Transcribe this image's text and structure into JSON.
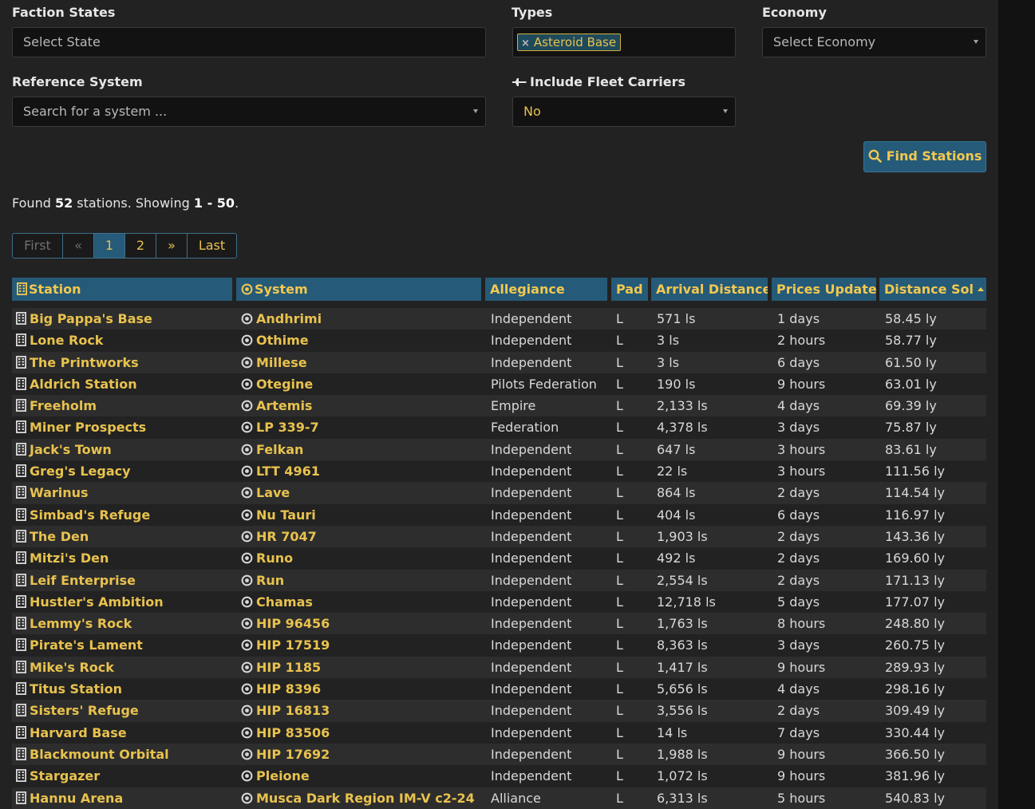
{
  "filters": {
    "faction_states": {
      "label": "Faction States",
      "placeholder": "Select State"
    },
    "types": {
      "label": "Types",
      "selected_tags": [
        "Asteroid Base"
      ]
    },
    "economy": {
      "label": "Economy",
      "placeholder": "Select Economy"
    },
    "reference_system": {
      "label": "Reference System",
      "placeholder": "Search for a system ..."
    },
    "fleet_carriers": {
      "label": "Include Fleet Carriers",
      "value": "No"
    },
    "find_button": "Find Stations"
  },
  "summary": {
    "prefix": "Found ",
    "count": "52",
    "middle": " stations. Showing ",
    "range": "1 - 50",
    "suffix": "."
  },
  "pagination": {
    "first": "First",
    "prev": "«",
    "pages": [
      "1",
      "2"
    ],
    "current": "1",
    "next": "»",
    "last": "Last"
  },
  "table": {
    "headers": {
      "station": "Station",
      "system": "System",
      "allegiance": "Allegiance",
      "pad": "Pad",
      "arrival": "Arrival Distance",
      "prices": "Prices Update",
      "distance": "Distance Sol"
    },
    "sorted_by": "distance",
    "sort_direction": "ascending",
    "rows": [
      {
        "station": "Big Pappa's Base",
        "system": "Andhrimi",
        "allegiance": "Independent",
        "pad": "L",
        "arrival": "571 ls",
        "prices": "1 days",
        "distance": "58.45 ly"
      },
      {
        "station": "Lone Rock",
        "system": "Othime",
        "allegiance": "Independent",
        "pad": "L",
        "arrival": "3 ls",
        "prices": "2 hours",
        "distance": "58.77 ly"
      },
      {
        "station": "The Printworks",
        "system": "Millese",
        "allegiance": "Independent",
        "pad": "L",
        "arrival": "3 ls",
        "prices": "6 days",
        "distance": "61.50 ly"
      },
      {
        "station": "Aldrich Station",
        "system": "Otegine",
        "allegiance": "Pilots Federation",
        "pad": "L",
        "arrival": "190 ls",
        "prices": "9 hours",
        "distance": "63.01 ly"
      },
      {
        "station": "Freeholm",
        "system": "Artemis",
        "allegiance": "Empire",
        "pad": "L",
        "arrival": "2,133 ls",
        "prices": "4 days",
        "distance": "69.39 ly"
      },
      {
        "station": "Miner Prospects",
        "system": "LP 339-7",
        "allegiance": "Federation",
        "pad": "L",
        "arrival": "4,378 ls",
        "prices": "3 days",
        "distance": "75.87 ly"
      },
      {
        "station": "Jack's Town",
        "system": "Felkan",
        "allegiance": "Independent",
        "pad": "L",
        "arrival": "647 ls",
        "prices": "3 hours",
        "distance": "83.61 ly"
      },
      {
        "station": "Greg's Legacy",
        "system": "LTT 4961",
        "allegiance": "Independent",
        "pad": "L",
        "arrival": "22 ls",
        "prices": "3 hours",
        "distance": "111.56 ly"
      },
      {
        "station": "Warinus",
        "system": "Lave",
        "allegiance": "Independent",
        "pad": "L",
        "arrival": "864 ls",
        "prices": "2 days",
        "distance": "114.54 ly"
      },
      {
        "station": "Simbad's Refuge",
        "system": "Nu Tauri",
        "allegiance": "Independent",
        "pad": "L",
        "arrival": "404 ls",
        "prices": "6 days",
        "distance": "116.97 ly"
      },
      {
        "station": "The Den",
        "system": "HR 7047",
        "allegiance": "Independent",
        "pad": "L",
        "arrival": "1,903 ls",
        "prices": "2 days",
        "distance": "143.36 ly"
      },
      {
        "station": "Mitzi's Den",
        "system": "Runo",
        "allegiance": "Independent",
        "pad": "L",
        "arrival": "492 ls",
        "prices": "2 days",
        "distance": "169.60 ly"
      },
      {
        "station": "Leif Enterprise",
        "system": "Run",
        "allegiance": "Independent",
        "pad": "L",
        "arrival": "2,554 ls",
        "prices": "2 days",
        "distance": "171.13 ly"
      },
      {
        "station": "Hustler's Ambition",
        "system": "Chamas",
        "allegiance": "Independent",
        "pad": "L",
        "arrival": "12,718 ls",
        "prices": "5 days",
        "distance": "177.07 ly"
      },
      {
        "station": "Lemmy's Rock",
        "system": "HIP 96456",
        "allegiance": "Independent",
        "pad": "L",
        "arrival": "1,763 ls",
        "prices": "8 hours",
        "distance": "248.80 ly"
      },
      {
        "station": "Pirate's Lament",
        "system": "HIP 17519",
        "allegiance": "Independent",
        "pad": "L",
        "arrival": "8,363 ls",
        "prices": "3 days",
        "distance": "260.75 ly"
      },
      {
        "station": "Mike's Rock",
        "system": "HIP 1185",
        "allegiance": "Independent",
        "pad": "L",
        "arrival": "1,417 ls",
        "prices": "9 hours",
        "distance": "289.93 ly"
      },
      {
        "station": "Titus Station",
        "system": "HIP 8396",
        "allegiance": "Independent",
        "pad": "L",
        "arrival": "5,656 ls",
        "prices": "4 days",
        "distance": "298.16 ly"
      },
      {
        "station": "Sisters' Refuge",
        "system": "HIP 16813",
        "allegiance": "Independent",
        "pad": "L",
        "arrival": "3,556 ls",
        "prices": "2 days",
        "distance": "309.49 ly"
      },
      {
        "station": "Harvard Base",
        "system": "HIP 83506",
        "allegiance": "Independent",
        "pad": "L",
        "arrival": "14 ls",
        "prices": "7 days",
        "distance": "330.44 ly"
      },
      {
        "station": "Blackmount Orbital",
        "system": "HIP 17692",
        "allegiance": "Independent",
        "pad": "L",
        "arrival": "1,988 ls",
        "prices": "9 hours",
        "distance": "366.50 ly"
      },
      {
        "station": "Stargazer",
        "system": "Pleione",
        "allegiance": "Independent",
        "pad": "L",
        "arrival": "1,072 ls",
        "prices": "9 hours",
        "distance": "381.96 ly"
      },
      {
        "station": "Hannu Arena",
        "system": "Musca Dark Region IM-V c2-24",
        "allegiance": "Alliance",
        "pad": "L",
        "arrival": "6,313 ls",
        "prices": "5 hours",
        "distance": "540.83 ly"
      }
    ]
  },
  "icons": {
    "station": "building-icon",
    "system": "target-icon",
    "fleet_carrier": "fleet-carrier-icon",
    "search": "search-icon",
    "dropdown": "chevron-down-icon",
    "remove_tag": "close-icon"
  },
  "colors": {
    "accent_gold": "#e8c24e",
    "header_blue": "#255a78",
    "panel_bg": "#222222",
    "field_bg": "#121212"
  }
}
